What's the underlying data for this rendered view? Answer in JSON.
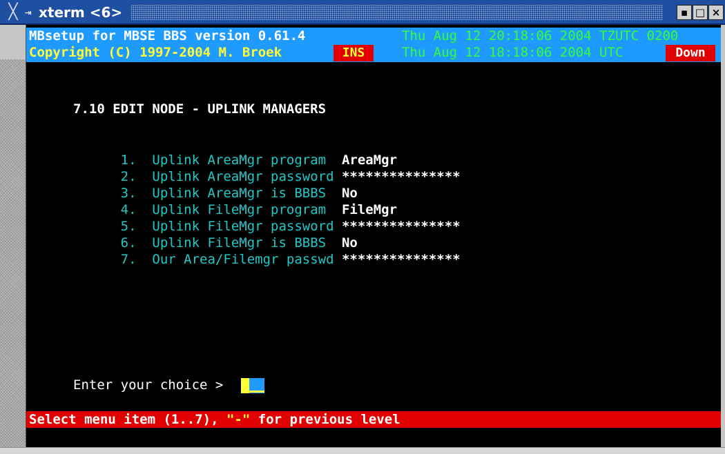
{
  "window": {
    "title": "xterm <6>",
    "title_icon": "terminal-icon",
    "buttons": {
      "minimize_icon": "minimize-icon",
      "maximize_icon": "maximize-icon",
      "close_icon": "close-icon",
      "minimize_glyph": "▪",
      "maximize_glyph": "□",
      "close_glyph": "×"
    }
  },
  "header": {
    "app_line": "MBsetup for MBSE BBS version 0.61.4",
    "copyright_line": "Copyright (C) 1997-2004 M. Broek",
    "ins_badge": "INS",
    "local_time": "Thu Aug 12 20:18:06 2004 TZUTC 0200",
    "utc_time": "Thu Aug 12 18:18:06 2004 UTC",
    "status_badge": "Down"
  },
  "screen": {
    "title": "7.10 EDIT NODE - UPLINK MANAGERS",
    "items": [
      {
        "num": "1.",
        "label": "Uplink AreaMgr program ",
        "value": "AreaMgr"
      },
      {
        "num": "2.",
        "label": "Uplink AreaMgr password",
        "value": "***************"
      },
      {
        "num": "3.",
        "label": "Uplink AreaMgr is BBBS ",
        "value": "No"
      },
      {
        "num": "4.",
        "label": "Uplink FileMgr program ",
        "value": "FileMgr"
      },
      {
        "num": "5.",
        "label": "Uplink FileMgr password",
        "value": "***************"
      },
      {
        "num": "6.",
        "label": "Uplink FileMgr is BBBS ",
        "value": "No"
      },
      {
        "num": "7.",
        "label": "Our Area/Filemgr passwd",
        "value": "***************"
      }
    ],
    "prompt": "Enter your choice > "
  },
  "status": {
    "prefix": "Select menu item (1..7), ",
    "quoted": "\"-\"",
    "suffix": " for previous level"
  },
  "colors": {
    "header_bg": "#1f9bff",
    "terminal_bg": "#000000",
    "menu_text": "#22c8c8",
    "status_bg": "#e00000",
    "time_text": "#33ff33",
    "accent_yellow": "#ffff33"
  }
}
